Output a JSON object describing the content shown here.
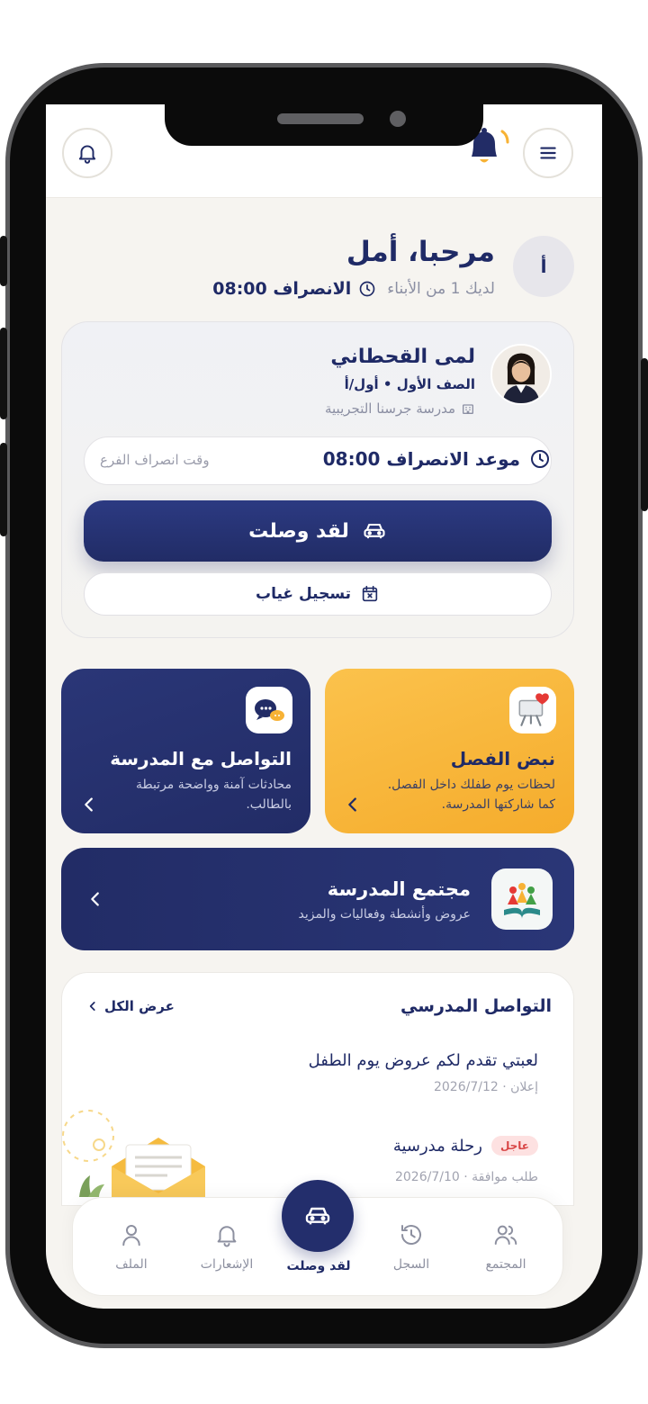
{
  "header": {
    "menu_icon": "hamburger-menu-icon",
    "bell_icon": "bell-icon",
    "brand_icon": "yellow-bell-logo"
  },
  "greeting": {
    "avatar_initial": "أ",
    "title": "مرحبا، أمل",
    "kids_count": "لديك 1 من الأبناء",
    "dismissal_time": "الانصراف 08:00"
  },
  "child": {
    "name": "لمى القحطاني",
    "class": "الصف الأول • أول/أ",
    "school": "مدرسة جرسنا التجريبية",
    "dismissal_label": "موعد الانصراف 08:00",
    "dismissal_hint": "وقت انصراف الفرع",
    "arrived_button": "لقد وصلت",
    "absence_button": "تسجيل غياب"
  },
  "tiles": {
    "pulse": {
      "title": "نبض الفصل",
      "line1": "لحظات يوم طفلك داخل الفصل.",
      "line2": "كما شاركتها المدرسة."
    },
    "comm": {
      "title": "التواصل مع المدرسة",
      "line1": "محادثات آمنة وواضحة مرتبطة",
      "line2": "بالطالب."
    },
    "community": {
      "title": "مجتمع المدرسة",
      "subtitle": "عروض وأنشطة وفعاليات والمزيد"
    }
  },
  "school_comm": {
    "title": "التواصل المدرسي",
    "view_all": "عرض الكل",
    "messages": [
      {
        "title": "لعبتي تقدم لكم عروض يوم الطفل",
        "meta": "إعلان · 2026/7/12",
        "badge": ""
      },
      {
        "title": "رحلة مدرسية",
        "meta": "طلب موافقة · 2026/7/10",
        "badge": "عاجل"
      }
    ]
  },
  "bottom_nav": {
    "community": "المجتمع",
    "history": "السجل",
    "arrived": "لقد وصلت",
    "notifications": "الإشعارات",
    "profile": "الملف"
  },
  "colors": {
    "navy": "#1f2a66",
    "amber": "#f7b235",
    "background": "#f6f4f0",
    "urgent": "#d84545"
  }
}
